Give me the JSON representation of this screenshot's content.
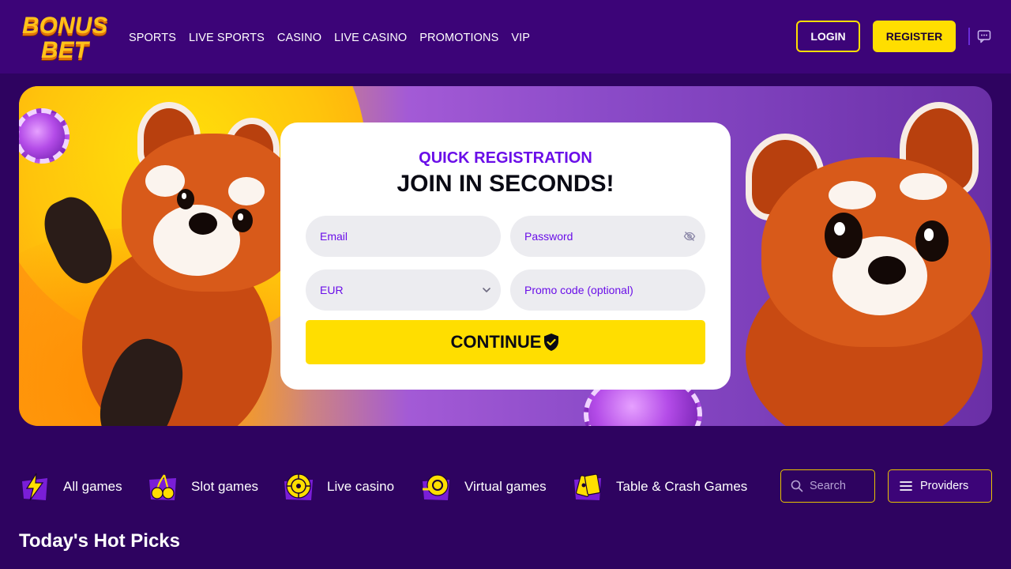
{
  "header": {
    "logo": {
      "line1": "BONUS",
      "line2": "BET"
    },
    "nav": [
      "SPORTS",
      "LIVE SPORTS",
      "CASINO",
      "LIVE CASINO",
      "PROMOTIONS",
      "VIP"
    ],
    "login_label": "LOGIN",
    "register_label": "REGISTER",
    "chat_icon": "chat-bubble-icon"
  },
  "registration": {
    "subtitle": "QUICK REGISTRATION",
    "title": "JOIN IN SECONDS!",
    "email_placeholder": "Email",
    "password_placeholder": "Password",
    "currency_value": "EUR",
    "promo_placeholder": "Promo code (optional)",
    "continue_label": "CONTINUE"
  },
  "categories": [
    {
      "label": "All games",
      "icon": "lightning-icon"
    },
    {
      "label": "Slot games",
      "icon": "cherry-icon"
    },
    {
      "label": "Live casino",
      "icon": "roulette-chip-icon"
    },
    {
      "label": "Virtual games",
      "icon": "reel-icon"
    },
    {
      "label": "Table & Crash Games",
      "icon": "cards-icon"
    }
  ],
  "search": {
    "placeholder": "Search"
  },
  "providers_label": "Providers",
  "section_title": "Today's Hot Picks",
  "colors": {
    "background": "#2e0360",
    "header": "#3c0478",
    "accent_yellow": "#ffde00",
    "accent_purple": "#6a0ee8"
  }
}
